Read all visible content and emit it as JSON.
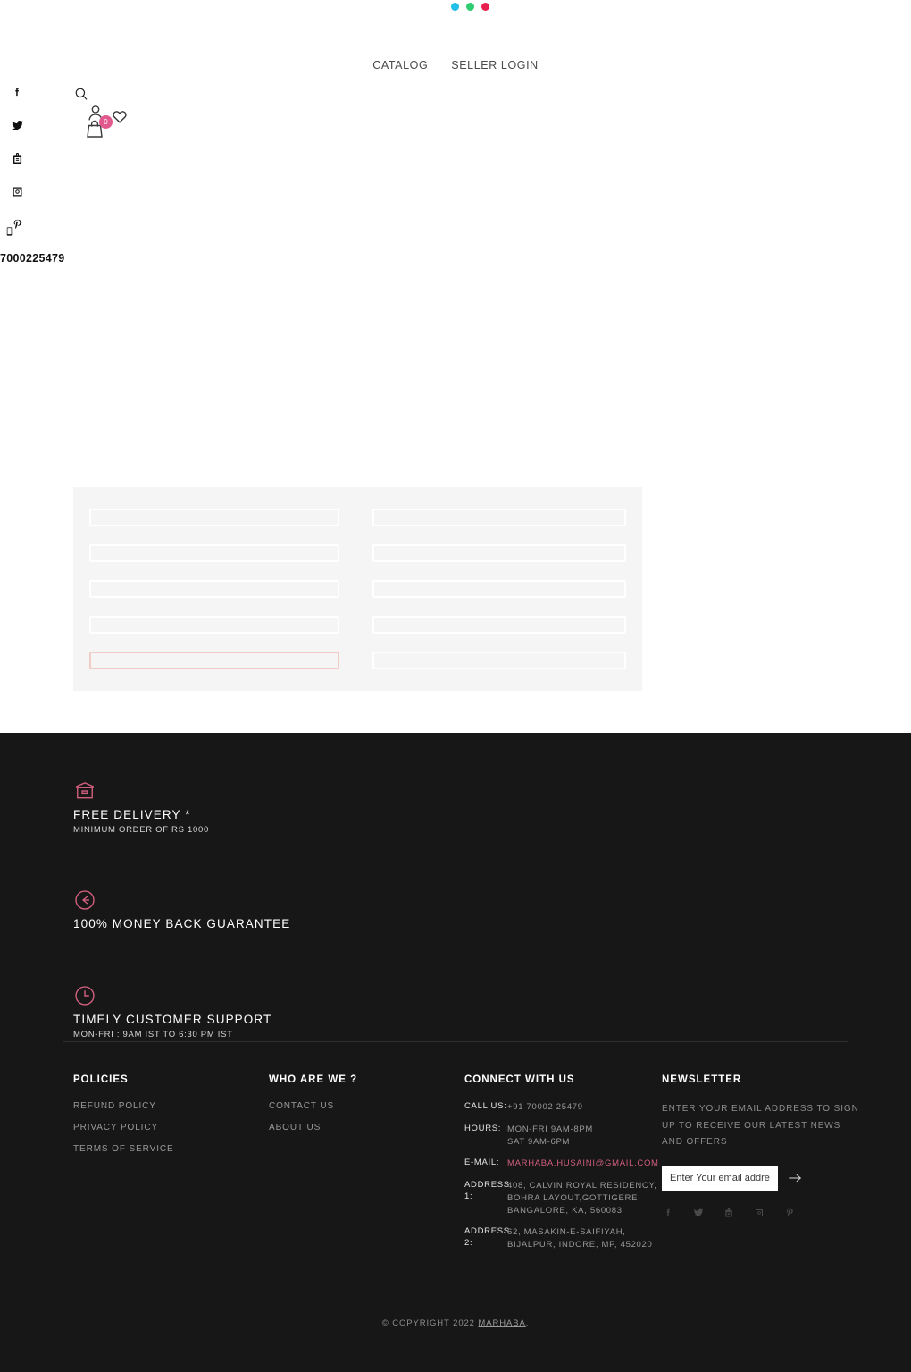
{
  "window": {
    "dots": [
      {
        "name": "dot-cyan",
        "color": "#22c0e8"
      },
      {
        "name": "dot-green",
        "color": "#2ecc71"
      },
      {
        "name": "dot-red",
        "color": "#e8204f"
      }
    ]
  },
  "nav": {
    "items": [
      {
        "label": "CATALOG"
      },
      {
        "label": "SELLER LOGIN"
      }
    ]
  },
  "social_rail": {
    "icons": [
      "facebook-icon",
      "twitter-icon",
      "youtube-icon",
      "instagram-icon",
      "pinterest-icon"
    ],
    "phone_icon": "mobile-phone-icon",
    "phone_number": "7000225479"
  },
  "utility": {
    "search_icon": "search-icon",
    "account_icon": "user-account-icon",
    "bag_icon": "shopping-bag-icon",
    "bag_count": "0",
    "wishlist_icon": "heart-icon"
  },
  "form": {
    "fields": [
      {
        "name": "form-field-1",
        "value": "",
        "placeholder": "",
        "state": "normal"
      },
      {
        "name": "form-field-2",
        "value": "",
        "placeholder": "",
        "state": "normal"
      },
      {
        "name": "form-field-3",
        "value": "",
        "placeholder": "",
        "state": "normal"
      },
      {
        "name": "form-field-4",
        "value": "",
        "placeholder": "",
        "state": "normal"
      },
      {
        "name": "form-field-5",
        "value": "",
        "placeholder": "",
        "state": "normal"
      },
      {
        "name": "form-field-6",
        "value": "",
        "placeholder": "",
        "state": "normal"
      },
      {
        "name": "form-field-7",
        "value": "",
        "placeholder": "",
        "state": "normal"
      },
      {
        "name": "form-field-8",
        "value": "",
        "placeholder": "",
        "state": "normal"
      },
      {
        "name": "form-field-9",
        "value": "",
        "placeholder": "",
        "state": "alert"
      },
      {
        "name": "form-field-10",
        "value": "",
        "placeholder": "",
        "state": "normal"
      }
    ],
    "panel_bg": "#f5f5f5",
    "alert_border": "#f0cdc4"
  },
  "features": [
    {
      "icon": "box-delivery-icon",
      "title": "FREE DELIVERY *",
      "subtitle": "MINIMUM ORDER OF RS 1000"
    },
    {
      "icon": "arrow-left-circle-icon",
      "title": "100% MONEY BACK GUARANTEE",
      "subtitle": ""
    },
    {
      "icon": "clock-icon",
      "title": "TIMELY CUSTOMER SUPPORT",
      "subtitle": "MON-FRI : 9AM IST TO 6:30 PM IST"
    }
  ],
  "footer": {
    "policies": {
      "heading": "POLICIES",
      "links": [
        "REFUND POLICY",
        "PRIVACY POLICY",
        "TERMS OF SERVICE"
      ]
    },
    "who": {
      "heading": "WHO ARE WE ?",
      "links": [
        "CONTACT US",
        "ABOUT US"
      ]
    },
    "connect": {
      "heading": "CONNECT WITH US",
      "rows": [
        {
          "label": "CALL US:",
          "lines": [
            "+91 70002 25479"
          ],
          "kind": "plain"
        },
        {
          "label": "HOURS:",
          "lines": [
            "MON-FRI 9AM-8PM",
            "SAT 9AM-6PM"
          ],
          "kind": "plain"
        },
        {
          "label": "E-MAIL:",
          "lines": [
            "MARHABA.HUSAINI@GMAIL.COM"
          ],
          "kind": "mail"
        },
        {
          "label": "ADDRESS 1:",
          "lines": [
            "408, CALVIN ROYAL RESIDENCY,",
            "BOHRA LAYOUT,GOTTIGERE,",
            "BANGALORE, KA, 560083"
          ],
          "kind": "plain"
        },
        {
          "label": "ADDRESS 2:",
          "lines": [
            "62, MASAKIN-E-SAIFIYAH,",
            "BIJALPUR, INDORE, MP, 452020"
          ],
          "kind": "plain"
        }
      ]
    },
    "newsletter": {
      "heading": "NEWSLETTER",
      "description": "ENTER YOUR EMAIL ADDRESS TO SIGN UP TO RECEIVE OUR LATEST NEWS AND OFFERS",
      "input_value": "",
      "input_placeholder": "Enter Your email address",
      "submit_icon": "arrow-right-icon",
      "social_icons": [
        "facebook-icon",
        "twitter-icon",
        "youtube-icon",
        "instagram-icon",
        "pinterest-icon"
      ]
    },
    "copyright_prefix": "© COPYRIGHT 2022 ",
    "copyright_brand": "MARHABA",
    "copyright_suffix": "."
  },
  "colors": {
    "accent_pink": "#d15f7e",
    "badge_pink": "#e0588c",
    "footer_bg": "#171717",
    "panel_bg": "#f5f5f5"
  }
}
